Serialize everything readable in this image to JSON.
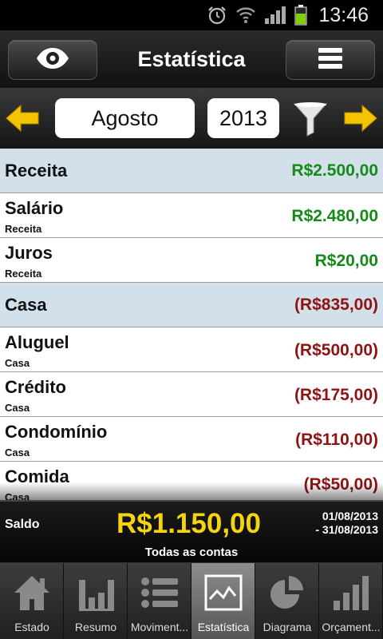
{
  "status_bar": {
    "time": "13:46"
  },
  "header": {
    "title": "Estatística"
  },
  "filter": {
    "month": "Agosto",
    "year": "2013"
  },
  "list": [
    {
      "type": "header",
      "name": "Receita",
      "amount": "R$2.500,00",
      "sign": "pos"
    },
    {
      "type": "item",
      "name": "Salário",
      "category": "Receita",
      "amount": "R$2.480,00",
      "sign": "pos"
    },
    {
      "type": "item",
      "name": "Juros",
      "category": "Receita",
      "amount": "R$20,00",
      "sign": "pos"
    },
    {
      "type": "header",
      "name": "Casa",
      "amount": "(R$835,00)",
      "sign": "neg"
    },
    {
      "type": "item",
      "name": "Aluguel",
      "category": "Casa",
      "amount": "(R$500,00)",
      "sign": "neg"
    },
    {
      "type": "item",
      "name": "Crédito",
      "category": "Casa",
      "amount": "(R$175,00)",
      "sign": "neg"
    },
    {
      "type": "item",
      "name": "Condomínio",
      "category": "Casa",
      "amount": "(R$110,00)",
      "sign": "neg"
    },
    {
      "type": "item",
      "name": "Comida",
      "category": "Casa",
      "amount": "(R$50,00)",
      "sign": "neg"
    }
  ],
  "balance": {
    "label": "Saldo",
    "value": "R$1.150,00",
    "date_from": "01/08/2013",
    "date_to": "- 31/08/2013",
    "accounts": "Todas as contas"
  },
  "tabs": {
    "estado": "Estado",
    "resumo": "Resumo",
    "movimentos": "Moviment...",
    "estatistica": "Estatística",
    "diagrama": "Diagrama",
    "orcamento": "Orçament..."
  },
  "colors": {
    "positive": "#168a16",
    "negative": "#8e1313",
    "balance": "#f5d40f",
    "header_row": "#d2e0ea",
    "arrow": "#f5c400"
  },
  "icons": {
    "view": "eye-icon",
    "menu": "hamburger-menu-icon",
    "prev": "arrow-left-icon",
    "next": "arrow-right-icon",
    "filter": "funnel-icon"
  }
}
